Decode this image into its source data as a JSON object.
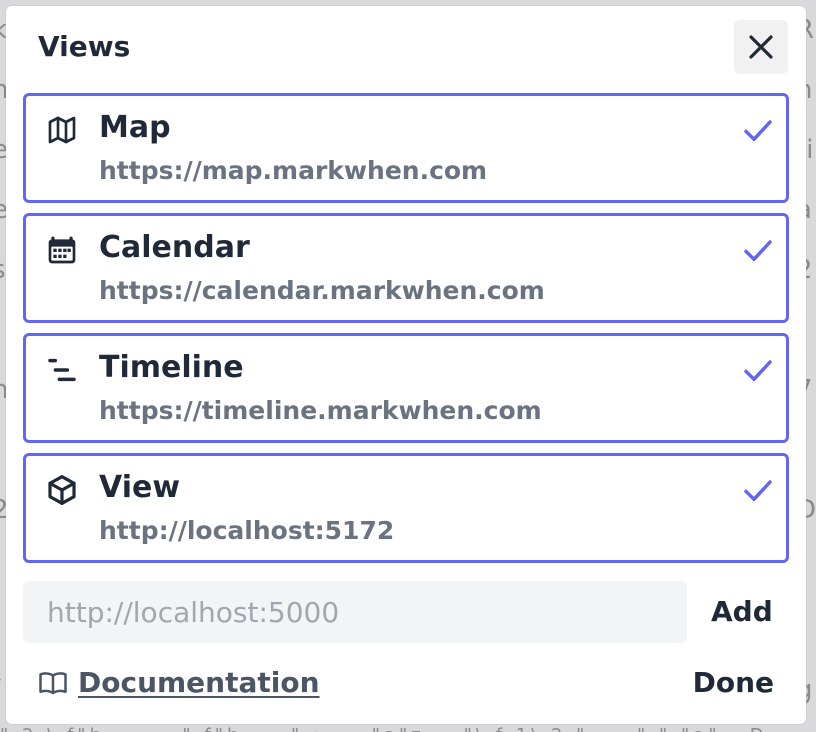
{
  "background": {
    "left_fragments": [
      "k",
      "n",
      "e",
      "e",
      "s",
      ":",
      "n",
      ":",
      "2",
      "",
      "(",
      "/",
      ")",
      "",
      ":"
    ],
    "right_fragments": [
      "R",
      "n",
      "ti",
      "a",
      "2",
      "",
      "7",
      ":",
      "D",
      "\"",
      "\"",
      "g",
      "c",
      "o",
      "",
      "D"
    ],
    "bottom_fragment": "\" 2 \\ f\"h ... = \" f\"h ... \" :  ... \"a\"z .. \"\\ f 1\\ 2 \" ... \" \" \"a\" . D"
  },
  "dialog": {
    "title": "Views",
    "close_icon": "close-icon",
    "views": [
      {
        "name": "Map",
        "url": "https://map.markwhen.com",
        "icon": "map-icon",
        "checked": true
      },
      {
        "name": "Calendar",
        "url": "https://calendar.markwhen.com",
        "icon": "calendar-icon",
        "checked": true
      },
      {
        "name": "Timeline",
        "url": "https://timeline.markwhen.com",
        "icon": "timeline-icon",
        "checked": true
      },
      {
        "name": "View",
        "url": "http://localhost:5172",
        "icon": "cube-icon",
        "checked": true
      }
    ],
    "add_input": {
      "value": "",
      "placeholder": "http://localhost:5000"
    },
    "add_label": "Add",
    "documentation_label": "Documentation",
    "documentation_icon": "book-icon",
    "done_label": "Done"
  },
  "colors": {
    "accent": "#6366f1",
    "text_primary": "#1f2937",
    "text_secondary": "#6b7280",
    "input_bg": "#f3f4f6"
  }
}
